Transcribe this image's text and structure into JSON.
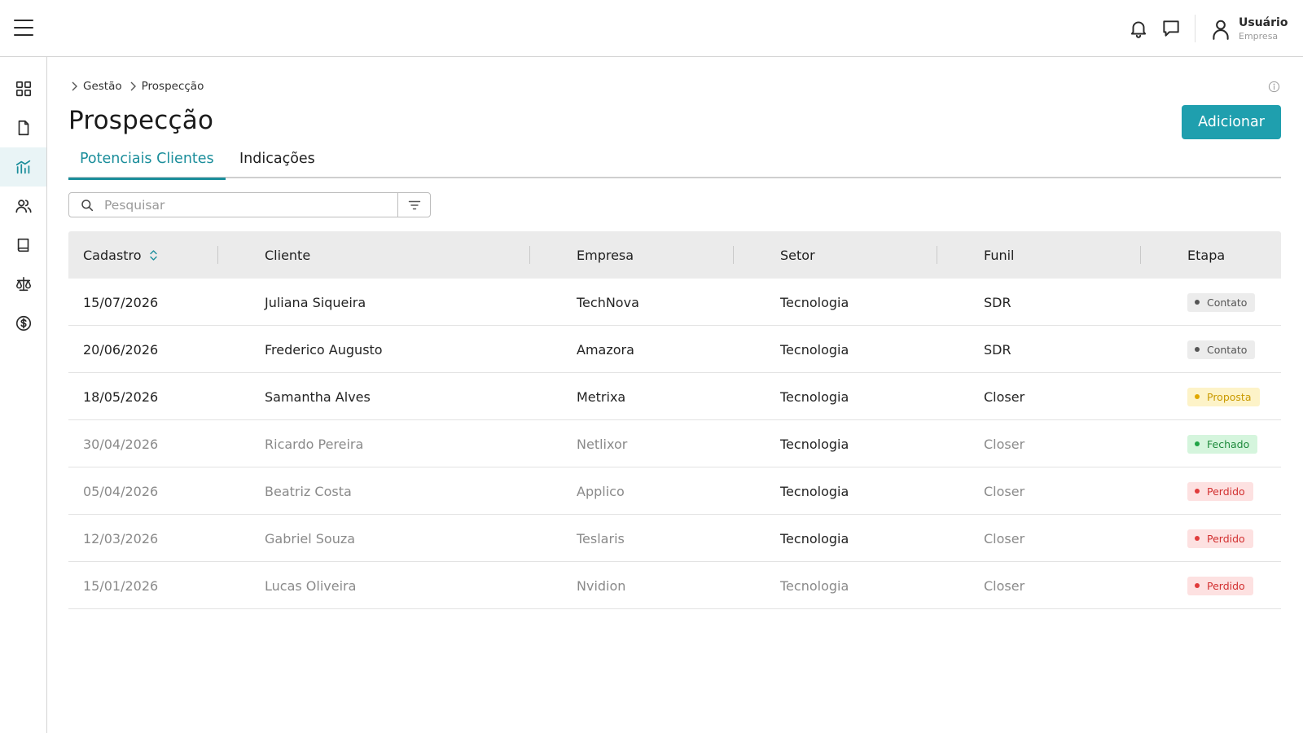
{
  "header": {
    "user_name": "Usuário",
    "user_company": "Empresa",
    "icons": [
      "menu-icon",
      "bell-icon",
      "chat-icon",
      "user-icon"
    ]
  },
  "sidebar": {
    "items": [
      {
        "name": "dashboard",
        "icon": "grid-icon",
        "active": false
      },
      {
        "name": "documents",
        "icon": "document-icon",
        "active": false
      },
      {
        "name": "management",
        "icon": "chart-icon",
        "active": true
      },
      {
        "name": "people",
        "icon": "users-icon",
        "active": false
      },
      {
        "name": "book",
        "icon": "book-icon",
        "active": false
      },
      {
        "name": "legal",
        "icon": "scale-icon",
        "active": false
      },
      {
        "name": "finance",
        "icon": "dollar-icon",
        "active": false
      }
    ],
    "accent": "#1b8e9b"
  },
  "breadcrumb": {
    "items": [
      "Gestão",
      "Prospecção"
    ]
  },
  "page": {
    "title": "Prospecção",
    "add_label": "Adicionar",
    "accent": "#1f9fae"
  },
  "tabs": [
    {
      "label": "Potenciais Clientes",
      "active": true
    },
    {
      "label": "Indicações",
      "active": false
    }
  ],
  "search": {
    "placeholder": "Pesquisar",
    "value": ""
  },
  "table": {
    "columns": [
      "Cadastro",
      "Cliente",
      "Empresa",
      "Setor",
      "Funil",
      "Etapa"
    ],
    "rows": [
      {
        "cadastro": "15/07/2026",
        "cliente": "Juliana Siqueira",
        "empresa": "TechNova",
        "setor": "Tecnologia",
        "funil": "SDR",
        "etapa": "Contato",
        "status": "contato"
      },
      {
        "cadastro": "20/06/2026",
        "cliente": "Frederico Augusto",
        "empresa": "Amazora",
        "setor": "Tecnologia",
        "funil": "SDR",
        "etapa": "Contato",
        "status": "contato"
      },
      {
        "cadastro": "18/05/2026",
        "cliente": "Samantha Alves",
        "empresa": "Metrixa",
        "setor": "Tecnologia",
        "funil": "Closer",
        "etapa": "Proposta",
        "status": "proposta"
      },
      {
        "cadastro": "30/04/2026",
        "cliente": "Ricardo Pereira",
        "empresa": "Netlixor",
        "setor": "Tecnologia",
        "funil": "Closer",
        "etapa": "Fechado",
        "status": "fechado"
      },
      {
        "cadastro": "05/04/2026",
        "cliente": "Beatriz Costa",
        "empresa": "Applico",
        "setor": "Tecnologia",
        "funil": "Closer",
        "etapa": "Perdido",
        "status": "perdido"
      },
      {
        "cadastro": "12/03/2026",
        "cliente": "Gabriel Souza",
        "empresa": "Teslaris",
        "setor": "Tecnologia",
        "funil": "Closer",
        "etapa": "Perdido",
        "status": "perdido"
      },
      {
        "cadastro": "15/01/2026",
        "cliente": "Lucas Oliveira",
        "empresa": "Nvidion",
        "setor": "Tecnologia",
        "funil": "Closer",
        "etapa": "Perdido",
        "status": "perdido"
      }
    ]
  },
  "status_colors": {
    "contato": {
      "bg": "#ececec",
      "fg": "#555555",
      "dot": "#555555"
    },
    "proposta": {
      "bg": "#fdf3c8",
      "fg": "#c99a00",
      "dot": "#e0a800"
    },
    "fechado": {
      "bg": "#d5f5dd",
      "fg": "#1e8a3c",
      "dot": "#22a447"
    },
    "perdido": {
      "bg": "#fde1e1",
      "fg": "#d23030",
      "dot": "#e03b3b"
    }
  }
}
